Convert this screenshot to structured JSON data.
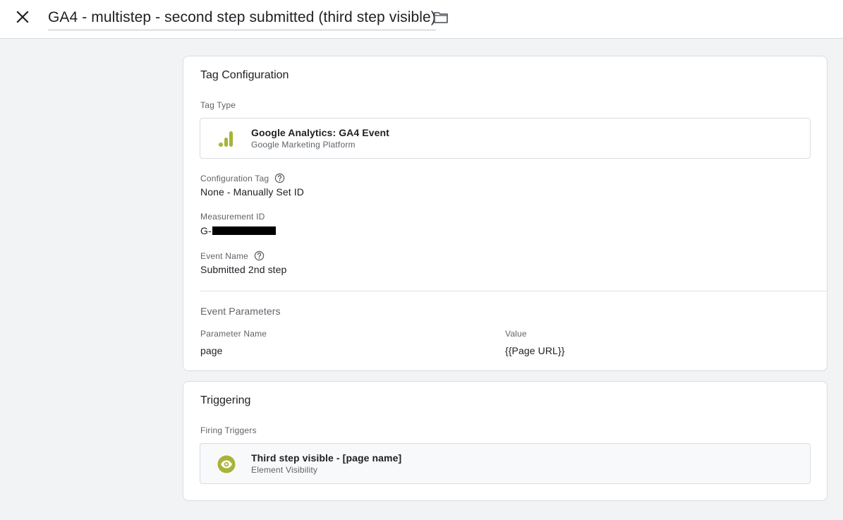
{
  "header": {
    "title": "GA4 - multistep - second step submitted (third step visible)",
    "close_icon": "close-icon",
    "folder_icon": "folder-icon"
  },
  "tag_configuration": {
    "title": "Tag Configuration",
    "tag_type_label": "Tag Type",
    "tag_type": {
      "name": "Google Analytics: GA4 Event",
      "platform": "Google Marketing Platform",
      "icon": "analytics-bars-icon",
      "icon_color": "#a8b33a"
    },
    "configuration_tag_label": "Configuration Tag",
    "configuration_tag_value": "None - Manually Set ID",
    "measurement_id_label": "Measurement ID",
    "measurement_id_prefix": "G-",
    "event_name_label": "Event Name",
    "event_name_value": "Submitted 2nd step",
    "event_parameters": {
      "title": "Event Parameters",
      "column_name": "Parameter Name",
      "column_value": "Value",
      "rows": [
        {
          "name": "page",
          "value": "{{Page URL}}"
        }
      ]
    }
  },
  "triggering": {
    "title": "Triggering",
    "firing_triggers_label": "Firing Triggers",
    "trigger": {
      "name": "Third step visible - [page name]",
      "type": "Element Visibility",
      "icon": "eye-icon",
      "icon_color": "#a8b33a"
    }
  }
}
